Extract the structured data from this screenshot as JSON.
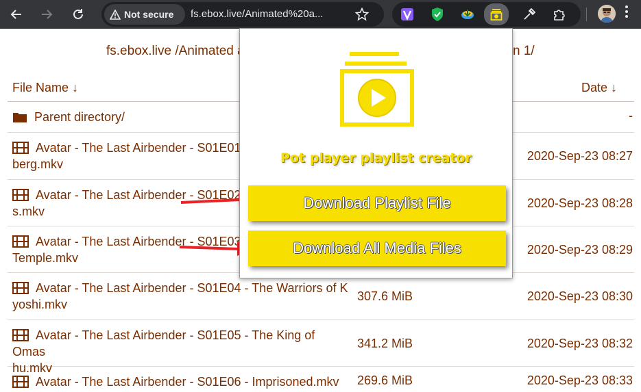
{
  "browser": {
    "security_label": "Not secure",
    "url": "fs.ebox.live/Animated%20a...",
    "extensions": [
      "vpn-icon",
      "adblock-shield-icon",
      "download-manager-icon",
      "pot-player-playlist-icon",
      "eyedropper-icon",
      "extensions-puzzle-icon"
    ]
  },
  "page": {
    "breadcrumb": "fs.ebox.live /Animated a",
    "breadcrumb_tail": "n 1/",
    "columns": {
      "name": "File Name  ↓",
      "date": "Date  ↓"
    },
    "parent": {
      "label": "Parent directory/",
      "date": "-"
    },
    "files": [
      {
        "name": "Avatar - The Last Airbender - S01E01 -",
        "name_line2": "berg.mkv",
        "size": "",
        "date": "2020-Sep-23 08:27"
      },
      {
        "name": "Avatar - The Last Airbender - S01E02",
        "name_line2": "s.mkv",
        "size": "",
        "date": "2020-Sep-23 08:28"
      },
      {
        "name": "Avatar - The Last Airbender - S01E03",
        "name_line2": "Temple.mkv",
        "size": "",
        "date": "2020-Sep-23 08:29"
      },
      {
        "name": "Avatar - The Last Airbender - S01E04 - The Warriors of K",
        "name_line2": "yoshi.mkv",
        "size": "307.6 MiB",
        "date": "2020-Sep-23 08:30"
      },
      {
        "name": "Avatar - The Last Airbender - S01E05 - The King of Omas",
        "name_line2": "hu.mkv",
        "size": "341.2 MiB",
        "date": "2020-Sep-23 08:32"
      },
      {
        "name": "Avatar - The Last Airbender - S01E06 - Imprisoned.mkv",
        "name_line2": "",
        "size": "269.6 MiB",
        "date": "2020-Sep-23 08:33"
      }
    ],
    "link_color": "#7a2e00"
  },
  "popup": {
    "title": "Pot player playlist creator",
    "download_playlist_label": "Download Playlist File",
    "download_media_label": "Download All Media Files",
    "accent_color": "#f7df00"
  },
  "annotations": {
    "arrow_color": "#e8242b"
  }
}
